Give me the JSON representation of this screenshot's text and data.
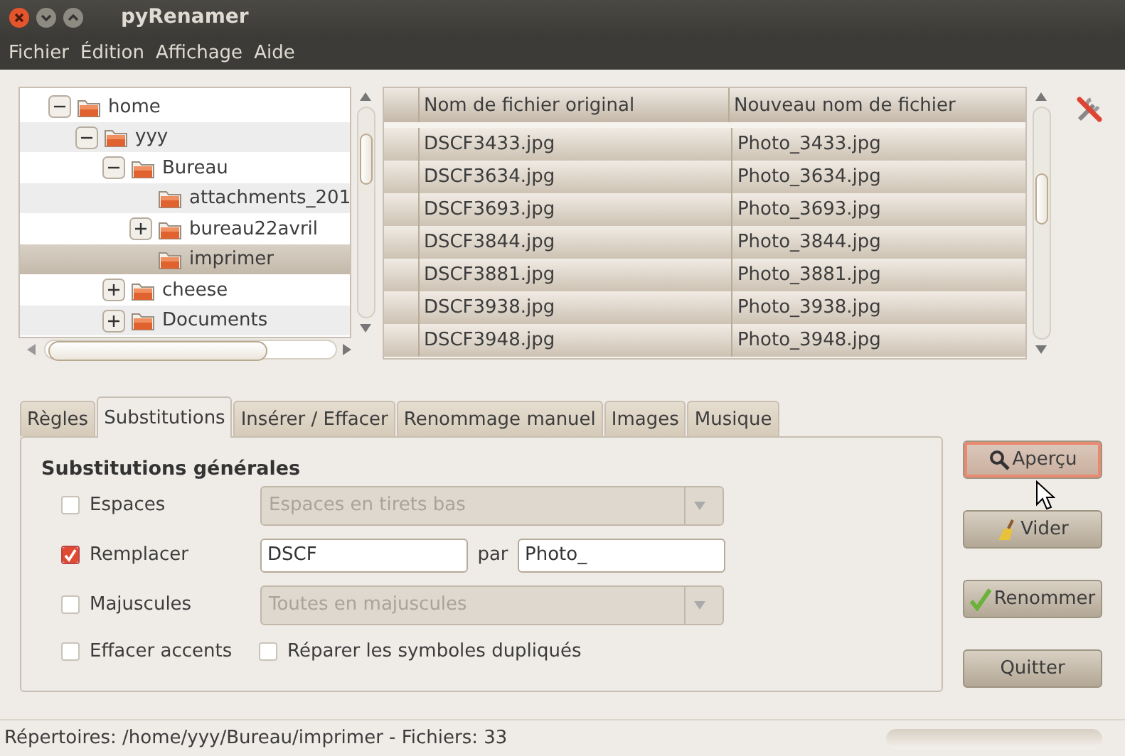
{
  "window": {
    "title": "pyRenamer"
  },
  "menu": [
    {
      "label": "Fichier"
    },
    {
      "label": "Édition"
    },
    {
      "label": "Affichage"
    },
    {
      "label": "Aide"
    }
  ],
  "tree": {
    "items": [
      {
        "label": "home",
        "expanded": true,
        "selected": false,
        "children": [
          {
            "label": "yyy",
            "expanded": true,
            "selected": false,
            "children": [
              {
                "label": "Bureau",
                "expanded": true,
                "selected": false,
                "children": [
                  {
                    "label": "attachments_201",
                    "selected": false
                  },
                  {
                    "label": "bureau22avril",
                    "expanded": false,
                    "selected": false
                  },
                  {
                    "label": "imprimer",
                    "selected": true
                  }
                ]
              },
              {
                "label": "cheese",
                "expanded": false,
                "selected": false
              },
              {
                "label": "Documents",
                "expanded": false,
                "selected": false
              }
            ]
          }
        ]
      }
    ]
  },
  "table": {
    "columns": [
      "Nom de fichier original",
      "Nouveau nom de fichier"
    ],
    "rows": [
      {
        "original": "DSCF3433.jpg",
        "new": "Photo_3433.jpg"
      },
      {
        "original": "DSCF3634.jpg",
        "new": "Photo_3634.jpg"
      },
      {
        "original": "DSCF3693.jpg",
        "new": "Photo_3693.jpg"
      },
      {
        "original": "DSCF3844.jpg",
        "new": "Photo_3844.jpg"
      },
      {
        "original": "DSCF3881.jpg",
        "new": "Photo_3881.jpg"
      },
      {
        "original": "DSCF3938.jpg",
        "new": "Photo_3938.jpg"
      },
      {
        "original": "DSCF3948.jpg",
        "new": "Photo_3948.jpg"
      }
    ]
  },
  "tabs": [
    {
      "label": "Règles",
      "selected": false
    },
    {
      "label": "Substitutions",
      "selected": true
    },
    {
      "label": "Insérer / Effacer",
      "selected": false
    },
    {
      "label": "Renommage manuel",
      "selected": false
    },
    {
      "label": "Images",
      "selected": false
    },
    {
      "label": "Musique",
      "selected": false
    }
  ],
  "substitutions": {
    "title": "Substitutions générales",
    "rows": [
      {
        "kind": "combo",
        "label": "Espaces",
        "checked": false,
        "value": "Espaces en tirets bas",
        "disabled": true
      },
      {
        "kind": "replace",
        "label": "Remplacer",
        "checked": true,
        "from": "DSCF",
        "joiner": "par",
        "to": "Photo_"
      },
      {
        "kind": "combo",
        "label": "Majuscules",
        "checked": false,
        "value": "Toutes en majuscules",
        "disabled": true
      },
      {
        "kind": "checks",
        "items": [
          {
            "label": "Effacer accents",
            "checked": false
          },
          {
            "label": "Réparer les symboles dupliqués",
            "checked": false
          }
        ]
      }
    ]
  },
  "buttons": [
    {
      "label": "Aperçu",
      "kind": "preview",
      "hovered": true
    },
    {
      "label": "Vider",
      "kind": "clear",
      "hovered": false
    },
    {
      "label": "Renommer",
      "kind": "rename",
      "hovered": false
    },
    {
      "label": "Quitter",
      "kind": "quit",
      "hovered": false
    }
  ],
  "status_bar": {
    "text": "Répertoires: /home/yyy/Bureau/imprimer - Fichiers: 33",
    "progress": {
      "level": 0
    }
  }
}
